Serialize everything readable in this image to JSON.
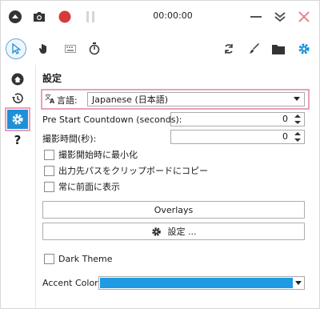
{
  "recorder": {
    "timer": "00:00:00",
    "icons": [
      "collapse-up-icon",
      "camera-icon",
      "record-icon",
      "pause-icon",
      "minimize-icon",
      "collapse-down-icon",
      "close-icon"
    ]
  },
  "tools": {
    "icons": [
      "pointer-icon",
      "hand-icon",
      "keyboard-icon",
      "stopwatch-icon",
      "refresh-icon",
      "brush-icon",
      "folder-icon",
      "settings-gear-icon"
    ]
  },
  "sidenav": {
    "items": [
      "home-icon",
      "history-icon",
      "settings-icon",
      "help-icon"
    ],
    "help_label": "?"
  },
  "settings": {
    "title": "設定",
    "language_label": "言語:",
    "language_value": "Japanese (日本語)",
    "countdown_label": "Pre Start Countdown (seconds):",
    "countdown_value": "0",
    "duration_label": "撮影時間(秒):",
    "duration_value": "0",
    "checkboxes": [
      {
        "label": "撮影開始時に最小化",
        "checked": false
      },
      {
        "label": "出力先パスをクリップボードにコピー",
        "checked": false
      },
      {
        "label": "常に前面に表示",
        "checked": false
      }
    ],
    "overlays_button": "Overlays",
    "settings_button": "設定 ...",
    "dark_theme_label": "Dark Theme",
    "dark_theme_checked": false,
    "accent_label": "Accent Color:",
    "accent_color": "#1e9be2"
  },
  "colors": {
    "brand_blue": "#1e90d8",
    "record_red": "#d43b3b",
    "close_red": "#e8848c",
    "highlight_pink": "#e8a0bc"
  }
}
